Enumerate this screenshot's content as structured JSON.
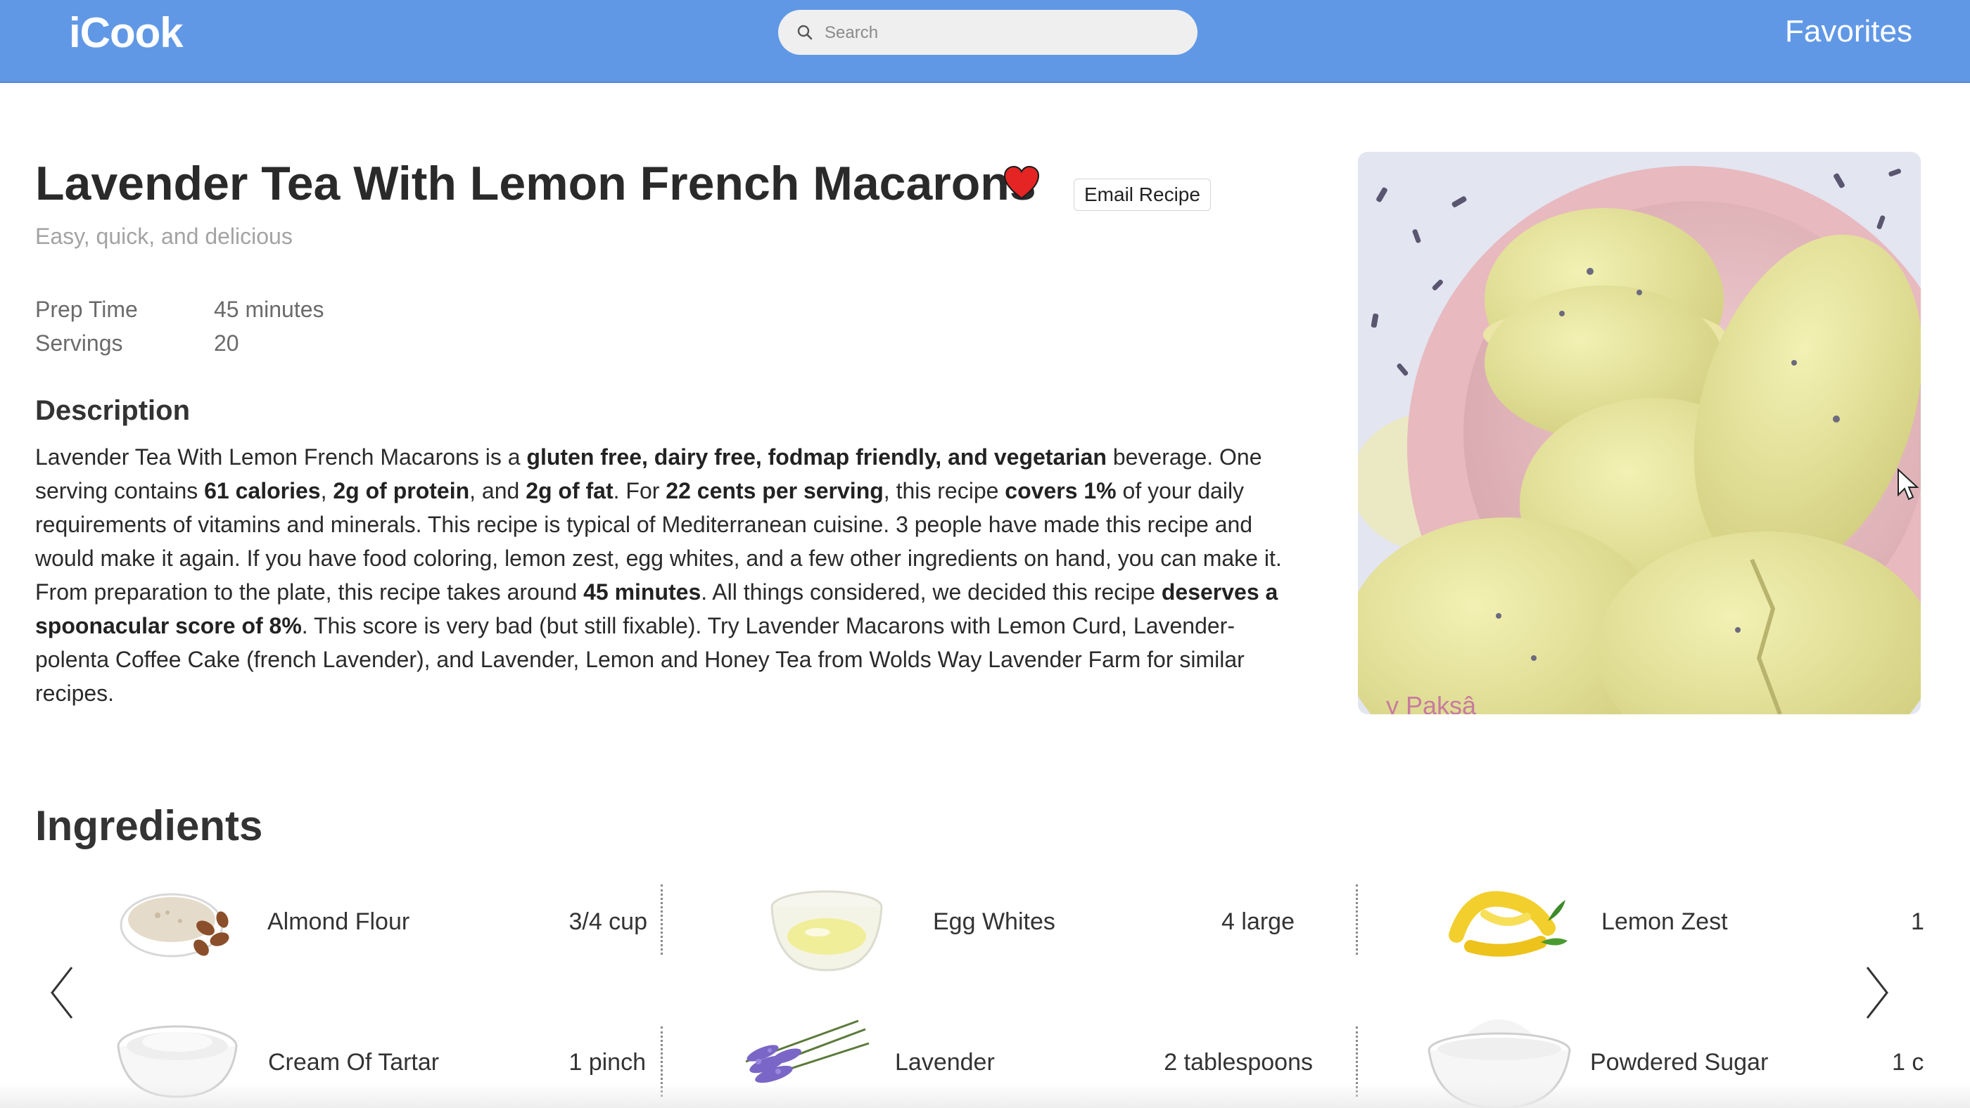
{
  "nav": {
    "brand": "iCook",
    "search_placeholder": "Search",
    "favorites_label": "Favorites"
  },
  "recipe": {
    "title": "Lavender Tea With Lemon French Macarons",
    "subtitle": "Easy, quick, and delicious",
    "email_button": "Email Recipe",
    "favorite_icon": "heart-icon",
    "favorite_color": "#e52424",
    "prep_time_label": "Prep Time",
    "prep_time_value": "45 minutes",
    "servings_label": "Servings",
    "servings_value": "20",
    "description_heading": "Description",
    "description": {
      "p1": "Lavender Tea With Lemon French Macarons is a ",
      "b1": "gluten free, dairy free, fodmap friendly, and vegetarian",
      "p2": " beverage. One serving contains ",
      "b2": "61 calories",
      "p3": ", ",
      "b3": "2g of protein",
      "p4": ", and ",
      "b4": "2g of fat",
      "p5": ". For ",
      "b5": "22 cents per serving",
      "p6": ", this recipe ",
      "b6": "covers 1%",
      "p7": " of your daily requirements of vitamins and minerals. This recipe is typical of Mediterranean cuisine. 3 people have made this recipe and would make it again. If you have food coloring, lemon zest, egg whites, and a few other ingredients on hand, you can make it. From preparation to the plate, this recipe takes around ",
      "b7": "45 minutes",
      "p8": ". All things considered, we decided this recipe ",
      "b8": "deserves a spoonacular score of 8%",
      "p9": ". This score is very bad (but still fixable). Try Lavender Macarons with Lemon Curd, Lavender-polenta Coffee Cake (french Lavender), and Lavender, Lemon and Honey Tea from Wolds Way Lavender Farm for similar recipes."
    },
    "photo_watermark": "y Pakşâ"
  },
  "ingredients": {
    "heading": "Ingredients",
    "items": [
      {
        "name": "Almond Flour",
        "amount": "3/4 cup",
        "icon": "almond-flour-icon"
      },
      {
        "name": "Egg Whites",
        "amount": "4 large",
        "icon": "egg-whites-icon"
      },
      {
        "name": "Lemon Zest",
        "amount": "1",
        "icon": "lemon-zest-icon"
      },
      {
        "name": "Cream Of Tartar",
        "amount": "1 pinch",
        "icon": "cream-of-tartar-icon"
      },
      {
        "name": "Lavender",
        "amount": "2 tablespoons",
        "icon": "lavender-icon"
      },
      {
        "name": "Powdered Sugar",
        "amount": "1 c",
        "icon": "powdered-sugar-icon"
      }
    ],
    "prev_icon": "chevron-left-icon",
    "next_icon": "chevron-right-icon"
  }
}
